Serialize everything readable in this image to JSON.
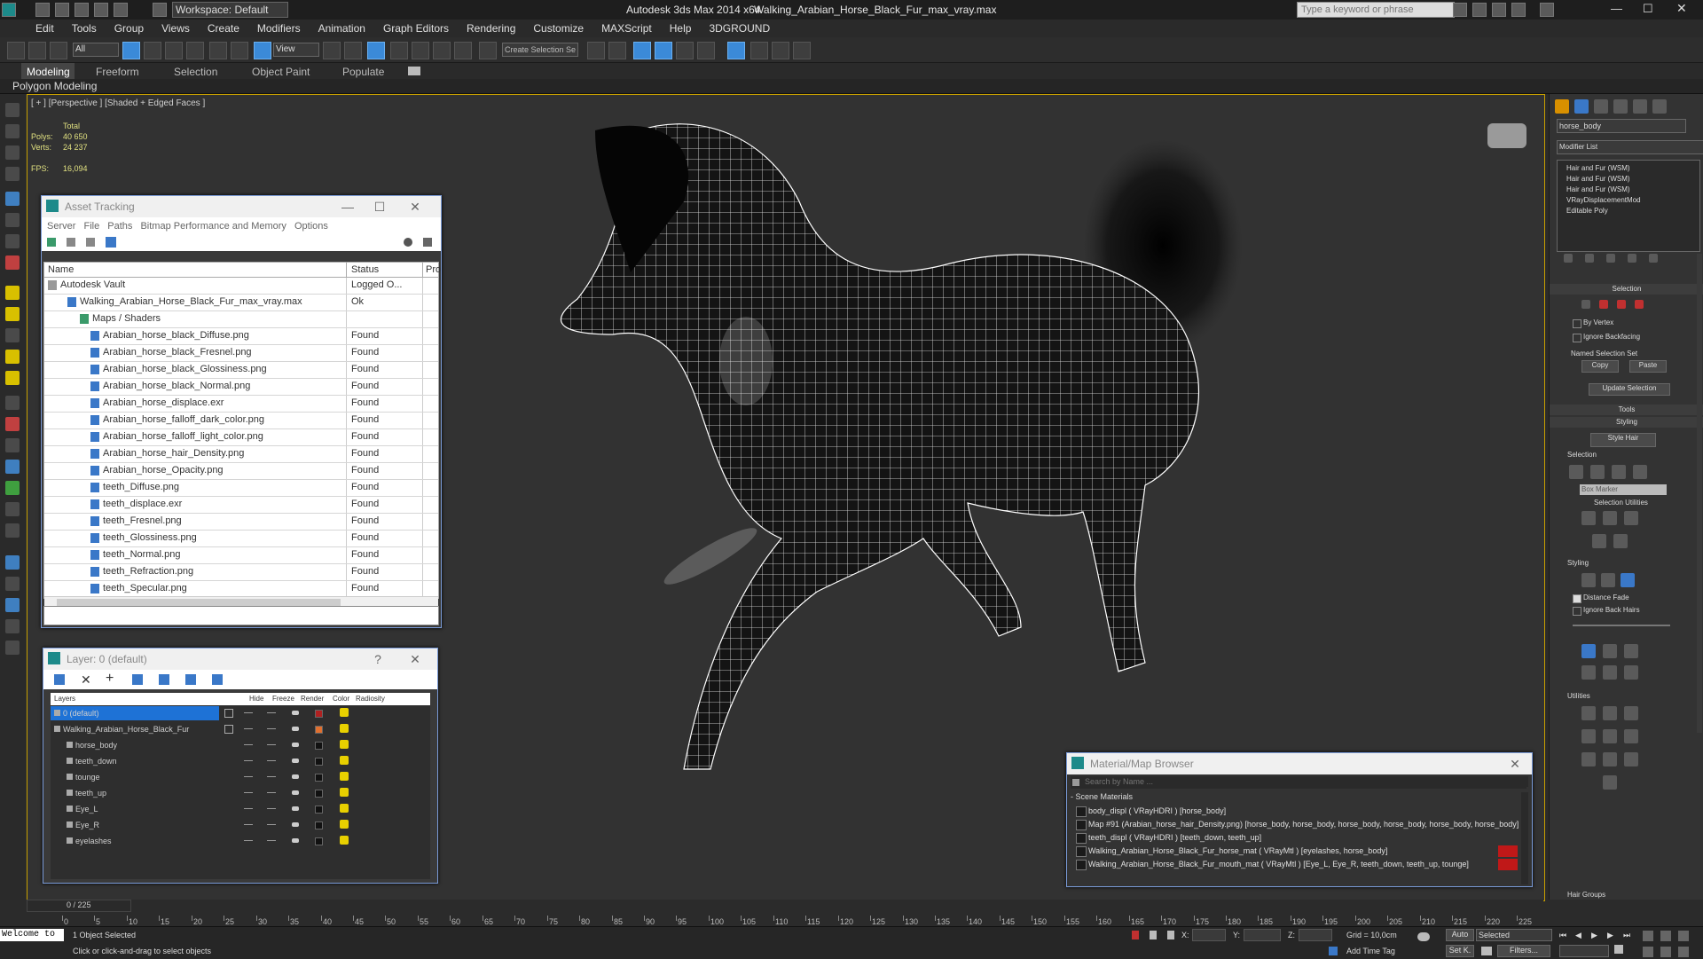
{
  "app": {
    "title": "Autodesk 3ds Max  2014 x64",
    "file": "Walking_Arabian_Horse_Black_Fur_max_vray.max",
    "workspace": "Workspace: Default",
    "search_placeholder": "Type a keyword or phrase"
  },
  "menu": [
    "Edit",
    "Tools",
    "Group",
    "Views",
    "Create",
    "Modifiers",
    "Animation",
    "Graph Editors",
    "Rendering",
    "Customize",
    "MAXScript",
    "Help",
    "3DGROUND"
  ],
  "toolbar": {
    "filter": "All",
    "coord": "View",
    "selection_set": "Create Selection Se"
  },
  "ribbon": {
    "tabs": [
      "Modeling",
      "Freeform",
      "Selection",
      "Object Paint",
      "Populate"
    ],
    "sub": "Polygon Modeling"
  },
  "viewport": {
    "label": "[ + ] [Perspective ] [Shaded + Edged Faces ]",
    "stats": {
      "total": "Total",
      "polys_label": "Polys:",
      "polys": "40 650",
      "verts_label": "Verts:",
      "verts": "24 237",
      "fps_label": "FPS:",
      "fps": "16,094"
    }
  },
  "asset_tracking": {
    "title": "Asset Tracking",
    "menu": [
      "Server",
      "File",
      "Paths",
      "Bitmap Performance and Memory",
      "Options"
    ],
    "columns": {
      "name": "Name",
      "status": "Status",
      "pro": "Pro"
    },
    "rows": [
      {
        "name": "Autodesk Vault",
        "status": "Logged O..."
      },
      {
        "name": "Walking_Arabian_Horse_Black_Fur_max_vray.max",
        "status": "Ok"
      },
      {
        "name": "Maps / Shaders",
        "status": ""
      },
      {
        "name": "Arabian_horse_black_Diffuse.png",
        "status": "Found"
      },
      {
        "name": "Arabian_horse_black_Fresnel.png",
        "status": "Found"
      },
      {
        "name": "Arabian_horse_black_Glossiness.png",
        "status": "Found"
      },
      {
        "name": "Arabian_horse_black_Normal.png",
        "status": "Found"
      },
      {
        "name": "Arabian_horse_displace.exr",
        "status": "Found"
      },
      {
        "name": "Arabian_horse_falloff_dark_color.png",
        "status": "Found"
      },
      {
        "name": "Arabian_horse_falloff_light_color.png",
        "status": "Found"
      },
      {
        "name": "Arabian_horse_hair_Density.png",
        "status": "Found"
      },
      {
        "name": "Arabian_horse_Opacity.png",
        "status": "Found"
      },
      {
        "name": "teeth_Diffuse.png",
        "status": "Found"
      },
      {
        "name": "teeth_displace.exr",
        "status": "Found"
      },
      {
        "name": "teeth_Fresnel.png",
        "status": "Found"
      },
      {
        "name": "teeth_Glossiness.png",
        "status": "Found"
      },
      {
        "name": "teeth_Normal.png",
        "status": "Found"
      },
      {
        "name": "teeth_Refraction.png",
        "status": "Found"
      },
      {
        "name": "teeth_Specular.png",
        "status": "Found"
      }
    ]
  },
  "layer": {
    "title": "Layer: 0 (default)",
    "columns": [
      "Layers",
      "Hide",
      "Freeze",
      "Render",
      "Color",
      "Radiosity"
    ],
    "rows": [
      {
        "name": "0 (default)"
      },
      {
        "name": "Walking_Arabian_Horse_Black_Fur"
      },
      {
        "name": "horse_body"
      },
      {
        "name": "teeth_down"
      },
      {
        "name": "tounge"
      },
      {
        "name": "teeth_up"
      },
      {
        "name": "Eye_L"
      },
      {
        "name": "Eye_R"
      },
      {
        "name": "eyelashes"
      }
    ]
  },
  "material_browser": {
    "title": "Material/Map Browser",
    "search": "Search by Name ...",
    "section": "- Scene Materials",
    "items": [
      "body_displ  ( VRayHDRI ) [horse_body]",
      "Map #91 (Arabian_horse_hair_Density.png) [horse_body, horse_body, horse_body, horse_body, horse_body, horse_body]",
      "teeth_displ  ( VRayHDRI ) [teeth_down, teeth_up]",
      "Walking_Arabian_Horse_Black_Fur_horse_mat  ( VRayMtl ) [eyelashes, horse_body]",
      "Walking_Arabian_Horse_Black_Fur_mouth_mat  ( VRayMtl ) [Eye_L, Eye_R, teeth_down, teeth_up, tounge]"
    ]
  },
  "command_panel": {
    "object_name": "horse_body",
    "modifier_list": "Modifier List",
    "stack": [
      "Hair and Fur (WSM)",
      "Hair and Fur (WSM)",
      "Hair and Fur (WSM)",
      "VRayDisplacementMod",
      "Editable Poly"
    ],
    "selection_header": "Selection",
    "by_vertex": "By Vertex",
    "ignore_backfacing": "Ignore Backfacing",
    "named_selection_set": "Named Selection Set",
    "copy": "Copy",
    "paste": "Paste",
    "update_selection": "Update Selection",
    "tools": "Tools",
    "styling": "Styling",
    "style_hair": "Style Hair",
    "selection2": "Selection",
    "box_marker": "Box Marker",
    "selection_utilities": "Selection Utilities",
    "styling2": "Styling",
    "distance_fade": "Distance Fade",
    "ignore_back_hairs": "Ignore Back Hairs",
    "utilities": "Utilities",
    "hair_groups": "Hair Groups"
  },
  "timeline": {
    "frame": "0 / 225",
    "ticks": [
      "0",
      "5",
      "10",
      "15",
      "20",
      "25",
      "30",
      "35",
      "40",
      "45",
      "50",
      "55",
      "60",
      "65",
      "70",
      "75",
      "80",
      "85",
      "90",
      "95",
      "100",
      "105",
      "110",
      "115",
      "120",
      "125",
      "130",
      "135",
      "140",
      "145",
      "150",
      "155",
      "160",
      "165",
      "170",
      "175",
      "180",
      "185",
      "190",
      "195",
      "200",
      "205",
      "210",
      "215",
      "220",
      "225"
    ]
  },
  "status": {
    "welcome": "Welcome  to",
    "objects": "1 Object Selected",
    "hint": "Click or click-and-drag to select objects",
    "grid": "Grid = 10,0cm",
    "add_time_tag": "Add Time Tag",
    "auto": "Auto",
    "selected": "Selected",
    "set_k": "Set K.",
    "filters": "Filters...",
    "x": "X:",
    "y": "Y:",
    "z": "Z:"
  }
}
